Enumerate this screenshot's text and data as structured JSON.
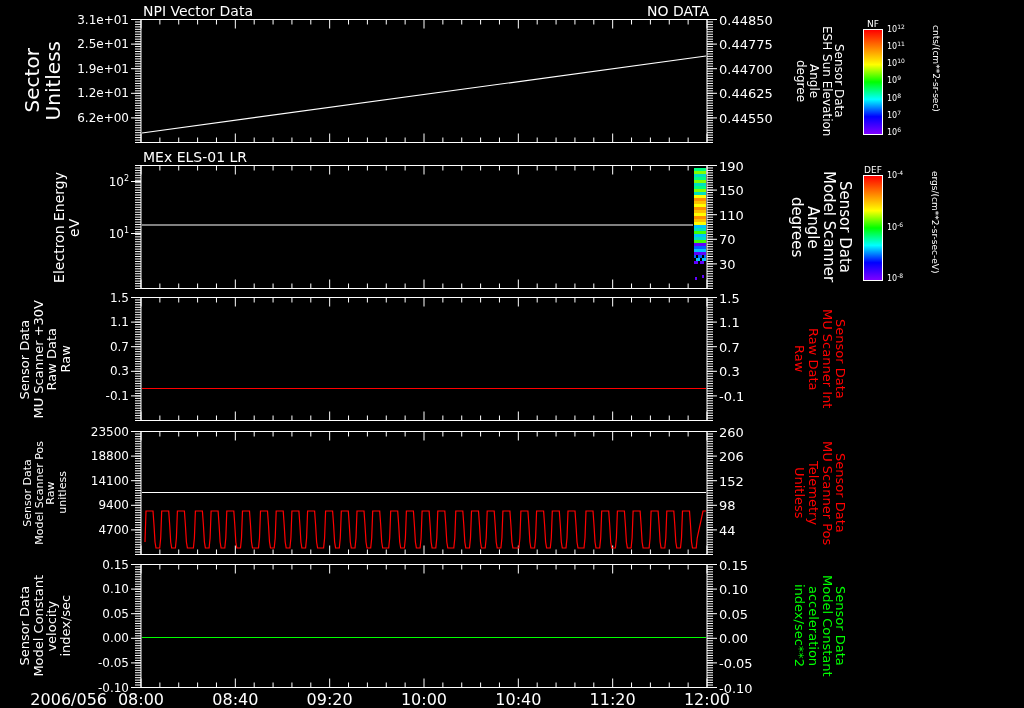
{
  "header": {
    "title": "NPI Vector Data",
    "status": "NO DATA"
  },
  "panels": [
    {
      "kind": "ramp",
      "left_label": {
        "lines": [
          "Sector",
          "Unitless"
        ],
        "color": "#ffffff"
      },
      "right_label": {
        "lines": [
          "Sensor Data",
          "ESH Sun Elevation",
          "Angle",
          "degree"
        ],
        "color": "#ffffff"
      },
      "left_ticks": [
        "3.1e+01",
        "2.5e+01",
        "1.9e+01",
        "1.2e+01",
        "6.2e+00"
      ],
      "right_ticks": [
        "0.44850",
        "0.44775",
        "0.44700",
        "0.44625",
        "0.44550"
      ],
      "colorbar": {
        "title": "NF",
        "ticks": [
          "10$^{12}$",
          "10$^{11}$",
          "10$^{10}$",
          "10$^{9}$",
          "10$^{8}$",
          "10$^{7}$",
          "10$^{6}$"
        ],
        "units": "cnts/(cm**2-sr-sec)"
      }
    },
    {
      "kind": "spectrogram",
      "title": "MEx ELS-01 LR",
      "left_label": {
        "lines": [
          "Electron Energy",
          "eV"
        ],
        "color": "#ffffff"
      },
      "right_label": {
        "lines": [
          "Sensor Data",
          "Model Scanner",
          "Angle",
          "degrees"
        ],
        "color": "#ffffff"
      },
      "left_ticks": [
        "10$^{2}$",
        "10$^{1}$"
      ],
      "right_ticks": [
        "190",
        "150",
        "110",
        "70",
        "30"
      ],
      "colorbar": {
        "title": "DEF",
        "ticks": [
          "10$^{-4}$",
          "10$^{-6}$",
          "10$^{-8}$"
        ],
        "units": "ergs/(cm**2-sr-sec-eV)"
      }
    },
    {
      "kind": "flat",
      "left_label": {
        "lines": [
          "Sensor Data",
          "MU Scanner +30V",
          "Raw Data",
          "Raw"
        ],
        "color": "#ffffff"
      },
      "right_label": {
        "lines": [
          "Sensor Data",
          "MU Scanner Int",
          "Raw Data",
          "Raw"
        ],
        "color": "#ff0000"
      },
      "left_ticks": [
        "1.5",
        "1.1",
        "0.7",
        "0.3",
        "-0.1"
      ],
      "right_ticks": [
        "1.5",
        "1.1",
        "0.7",
        "0.3",
        "-0.1"
      ]
    },
    {
      "kind": "pulse",
      "left_label": {
        "lines": [
          "Sensor Data",
          "Model Scanner Pos",
          "Raw",
          "unitless"
        ],
        "color": "#ffffff"
      },
      "right_label": {
        "lines": [
          "Sensor Data",
          "MU Scanner Pos",
          "Telemetry",
          "Unitless"
        ],
        "color": "#ff0000"
      },
      "left_ticks": [
        "23500",
        "18800",
        "14100",
        "9400",
        "4700"
      ],
      "right_ticks": [
        "260",
        "206",
        "152",
        "98",
        "44"
      ]
    },
    {
      "kind": "flat",
      "left_label": {
        "lines": [
          "Sensor Data",
          "Model Constant",
          "velocity",
          "index/sec"
        ],
        "color": "#ffffff"
      },
      "right_label": {
        "lines": [
          "Sensor Data",
          "Model Constant",
          "acceleration",
          "index/sec**2"
        ],
        "color": "#00ff00"
      },
      "left_ticks": [
        "0.15",
        "0.10",
        "0.05",
        "0.00",
        "-0.05",
        "-0.10"
      ],
      "right_ticks": [
        "0.15",
        "0.10",
        "0.05",
        "0.00",
        "-0.05",
        "-0.10"
      ]
    }
  ],
  "time_axis": {
    "date": "2006/056",
    "ticks": [
      "08:00",
      "08:40",
      "09:20",
      "10:00",
      "10:40",
      "11:20",
      "12:00"
    ]
  }
}
